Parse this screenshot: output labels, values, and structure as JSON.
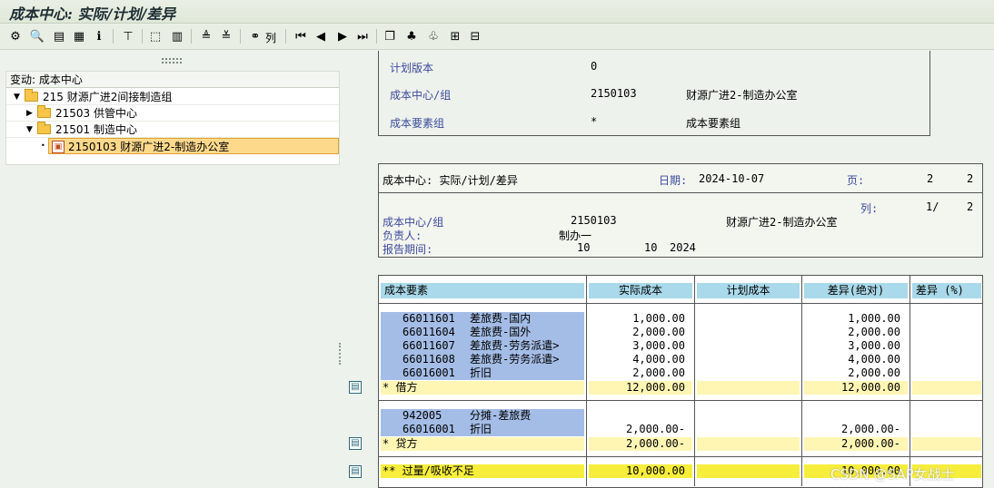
{
  "window": {
    "title": "成本中心: 实际/计划/差异"
  },
  "toolbar": {
    "icons": [
      "hierarchy-icon",
      "search-icon",
      "print-icon",
      "layout-icon",
      "info-icon",
      "filter-icon",
      "select-icon",
      "column-icon",
      "sort-asc-icon",
      "sort-desc-icon",
      "binoculars-icon",
      "first-icon",
      "prev-icon",
      "next-icon",
      "last-icon",
      "expand-icon",
      "tree-icon",
      "tree2-icon",
      "export-icon",
      "export2-icon"
    ],
    "column_label": "列"
  },
  "tree": {
    "header": "变动: 成本中心",
    "nodes": [
      {
        "label": "215 财源广进2间接制造组"
      },
      {
        "label": "21503 供管中心"
      },
      {
        "label": "21501 制造中心"
      },
      {
        "label": "2150103 财源广进2-制造办公室"
      }
    ]
  },
  "info": {
    "plan_version_label": "计划版本",
    "plan_version_value": "0",
    "cc_group_label": "成本中心/组",
    "cc_group_value": "2150103",
    "cc_group_name": "财源广进2-制造办公室",
    "ce_group_label": "成本要素组",
    "ce_group_value": "*",
    "ce_group_name": "成本要素组"
  },
  "report_header": {
    "title": "成本中心: 实际/计划/差异",
    "date_label": "日期:",
    "date_value": "2024-10-07",
    "page_label": "页:",
    "page_value": "2",
    "page_total": "2",
    "col_label": "列:",
    "col_value": "1/",
    "col_total": "2",
    "cc_label": "成本中心/组",
    "cc_value": "2150103",
    "cc_name": "财源广进2-制造办公室",
    "person_label": "负责人:",
    "person_value": "制办一",
    "period_label": "报告期间:",
    "period_from": "10",
    "period_to": "10",
    "period_year": "2024"
  },
  "grid": {
    "headers": [
      "成本要素",
      "实际成本",
      "计划成本",
      "差异(绝对)",
      "差异 (%)"
    ],
    "debit_rows": [
      {
        "code": "66011601",
        "name": "差旅费-国内",
        "actual": "1,000.00",
        "plan": "",
        "diff": "1,000.00"
      },
      {
        "code": "66011604",
        "name": "差旅费-国外",
        "actual": "2,000.00",
        "plan": "",
        "diff": "2,000.00"
      },
      {
        "code": "66011607",
        "name": "差旅费-劳务派遣>",
        "actual": "3,000.00",
        "plan": "",
        "diff": "3,000.00"
      },
      {
        "code": "66011608",
        "name": "差旅费-劳务派遣>",
        "actual": "4,000.00",
        "plan": "",
        "diff": "4,000.00"
      },
      {
        "code": "66016001",
        "name": "折旧",
        "actual": "2,000.00",
        "plan": "",
        "diff": "2,000.00"
      }
    ],
    "debit_total": {
      "label": "*  借方",
      "actual": "12,000.00",
      "diff": "12,000.00"
    },
    "credit_rows": [
      {
        "code": "942005",
        "name": "分摊-差旅费",
        "actual": "",
        "plan": "",
        "diff": ""
      },
      {
        "code": "66016001",
        "name": "折旧",
        "actual": "2,000.00-",
        "plan": "",
        "diff": "2,000.00-"
      }
    ],
    "credit_total": {
      "label": "*  贷方",
      "actual": "2,000.00-",
      "diff": "2,000.00-"
    },
    "grand_total": {
      "label": "** 过量/吸收不足",
      "actual": "10,000.00",
      "diff": "10,000.00"
    }
  },
  "watermark": "CSDN @SAP女战士",
  "colors": {
    "header_cell": "#a9d9ea",
    "account_cell": "#a4bde6",
    "subtotal": "#fff6b4",
    "total": "#f7ee3c"
  }
}
